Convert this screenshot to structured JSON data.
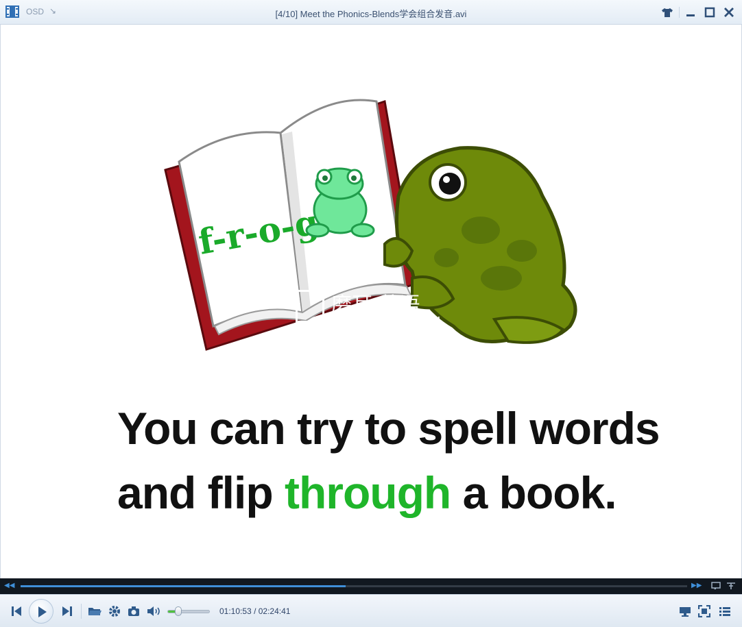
{
  "window": {
    "title": "[4/10] Meet the Phonics-Blends学会组合发音.avi",
    "osd_label": "OSD",
    "icons": [
      "film-icon",
      "arrow-down-right-icon",
      "shirt-icon",
      "minimize-icon",
      "maximize-icon",
      "close-icon"
    ]
  },
  "video": {
    "book_word": "f-r-o-g",
    "caption_line1": "You can try to spell words",
    "caption_line2_before": "and flip",
    "caption_line2_highlight": "through",
    "caption_line2_after": "a book.",
    "highlight_color": "#1fb52a",
    "watermark_text": "磨耳 英语",
    "watermark_sub": "O.COM"
  },
  "seekbar": {
    "progress": 0.4876,
    "accent_color": "#3f8fd8",
    "icons": [
      "rewind-icon",
      "fast-forward-icon",
      "repeat-icon",
      "pin-icon"
    ]
  },
  "controls": {
    "current_time": "01:10:53",
    "separator": "/",
    "total_time": "02:24:41",
    "volume": 0.25,
    "icons": [
      "previous-icon",
      "play-icon",
      "next-icon",
      "open-folder-icon",
      "settings-icon",
      "screenshot-icon",
      "volume-icon",
      "display-icon",
      "fullscreen-icon",
      "playlist-icon"
    ]
  }
}
